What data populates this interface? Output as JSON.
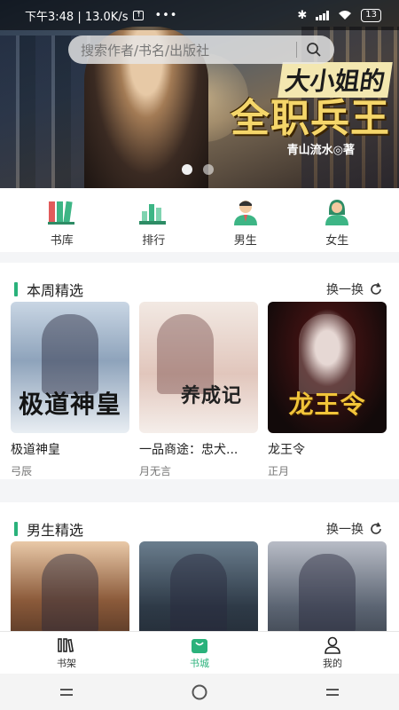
{
  "status_bar": {
    "time_speed": "下午3:48 | 13.0K/s",
    "more": "•••",
    "battery": "13"
  },
  "banner": {
    "title_line1": "大小姐的",
    "title_line2": "全职兵王",
    "author_line": "青山流水◎著"
  },
  "search": {
    "placeholder": "搜索作者/书名/出版社"
  },
  "categories": [
    {
      "label": "书库",
      "icon": "bookshelf-icon"
    },
    {
      "label": "排行",
      "icon": "ranking-icon"
    },
    {
      "label": "男生",
      "icon": "male-reader-icon"
    },
    {
      "label": "女生",
      "icon": "female-reader-icon"
    }
  ],
  "sections": [
    {
      "title": "本周精选",
      "swap": "换一换",
      "books": [
        {
          "title": "极道神皇",
          "author": "弓辰",
          "cover_text": "极道神皇"
        },
        {
          "title": "一品商途：忠犬...",
          "author": "月无言",
          "cover_text": "养成记"
        },
        {
          "title": "龙王令",
          "author": "正月",
          "cover_text": "龙王令"
        }
      ]
    },
    {
      "title": "男生精选",
      "swap": "换一换"
    }
  ],
  "tabbar": [
    {
      "label": "书架",
      "icon": "bookshelf-tab-icon"
    },
    {
      "label": "书城",
      "icon": "bookstore-bag-icon",
      "active": true
    },
    {
      "label": "我的",
      "icon": "profile-icon"
    }
  ],
  "colors": {
    "accent": "#2ab27b"
  }
}
